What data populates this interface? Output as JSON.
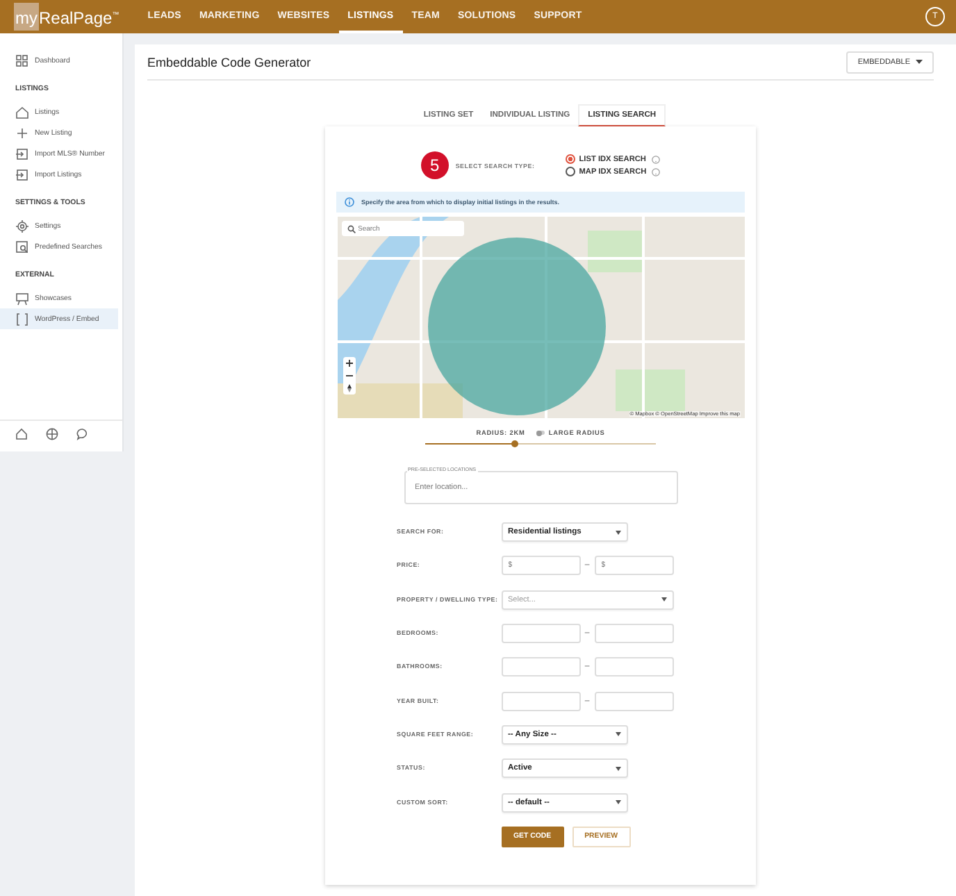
{
  "header": {
    "logo_prefix": "my",
    "logo_name": "RealPage$^{™}$",
    "nav": [
      {
        "label": "LEADS",
        "selected": false
      },
      {
        "label": "MARKETING",
        "selected": false
      },
      {
        "label": "WEBSITES",
        "selected": false
      },
      {
        "label": "LISTINGS",
        "selected": true
      },
      {
        "label": "TEAM",
        "selected": false
      },
      {
        "label": "SOLUTIONS",
        "selected": false
      },
      {
        "label": "SUPPORT",
        "selected": false
      }
    ],
    "avatar": "T"
  },
  "sidebar": {
    "sections": [
      {
        "items": [
          {
            "label": "Dashboard",
            "selected": false
          }
        ]
      },
      {
        "heading": "LISTINGS",
        "items": [
          {
            "label": "Listings",
            "selected": false
          },
          {
            "label": "New Listing",
            "selected": false
          },
          {
            "label": "Import MLS® Number",
            "selected": false
          },
          {
            "label": "Import Listings",
            "selected": false
          }
        ]
      },
      {
        "heading": "SETTINGS & TOOLS",
        "items": [
          {
            "label": "Settings",
            "selected": false
          },
          {
            "label": "Predefined Searches",
            "selected": false
          }
        ]
      },
      {
        "heading": "EXTERNAL",
        "items": [
          {
            "label": "Showcases",
            "selected": false
          },
          {
            "label": "WordPress / Embed",
            "selected": true
          }
        ]
      }
    ]
  },
  "page": {
    "title": "Embeddable Code Generator",
    "menu_button": "EMBEDDABLE",
    "tabs": [
      {
        "label": "LISTING SET",
        "selected": false
      },
      {
        "label": "INDIVIDUAL LISTING",
        "selected": false
      },
      {
        "label": "LISTING SEARCH",
        "selected": true
      }
    ],
    "step_badge": "5",
    "search_type_label": "SELECT SEARCH TYPE:",
    "search_types": [
      {
        "label": "LIST IDX SEARCH",
        "selected": true
      },
      {
        "label": "MAP IDX SEARCH",
        "selected": false
      }
    ],
    "info": "Specify the area from which to display initial listings in the results.",
    "map": {
      "search_placeholder": "Search",
      "attribution": "© Mapbox © OpenStreetMap Improve this map"
    },
    "radius": {
      "label": "RADIUS: 2KM",
      "toggle_label": "LARGE RADIUS",
      "large_radius": false,
      "level": 0.39
    },
    "locations": {
      "label": "PRE-SELECTED LOCATIONS",
      "placeholder": "Enter location..."
    },
    "fields": [
      {
        "label": "SEARCH FOR:",
        "kind": "select",
        "value": "Residential listings"
      },
      {
        "label": "PRICE:",
        "kind": "range",
        "from_placeholder": "$",
        "separator": "–",
        "to_placeholder": "$"
      },
      {
        "label": "PROPERTY / DWELLING TYPE:",
        "kind": "long-select",
        "placeholder": "Select..."
      },
      {
        "label": "BEDROOMS:",
        "kind": "range",
        "separator": "–"
      },
      {
        "label": "BATHROOMS:",
        "kind": "range",
        "separator": "–"
      },
      {
        "label": "YEAR BUILT:",
        "kind": "range",
        "separator": "–"
      },
      {
        "label": "SQUARE FEET RANGE:",
        "kind": "select",
        "value": "-- Any Size --"
      },
      {
        "label": "STATUS:",
        "kind": "select",
        "value": "Active"
      },
      {
        "label": "CUSTOM SORT:",
        "kind": "select",
        "value": "-- default --"
      }
    ],
    "buttons": [
      {
        "label": "GET CODE",
        "kind": "primary"
      },
      {
        "label": "PREVIEW",
        "kind": "secondary"
      }
    ]
  }
}
